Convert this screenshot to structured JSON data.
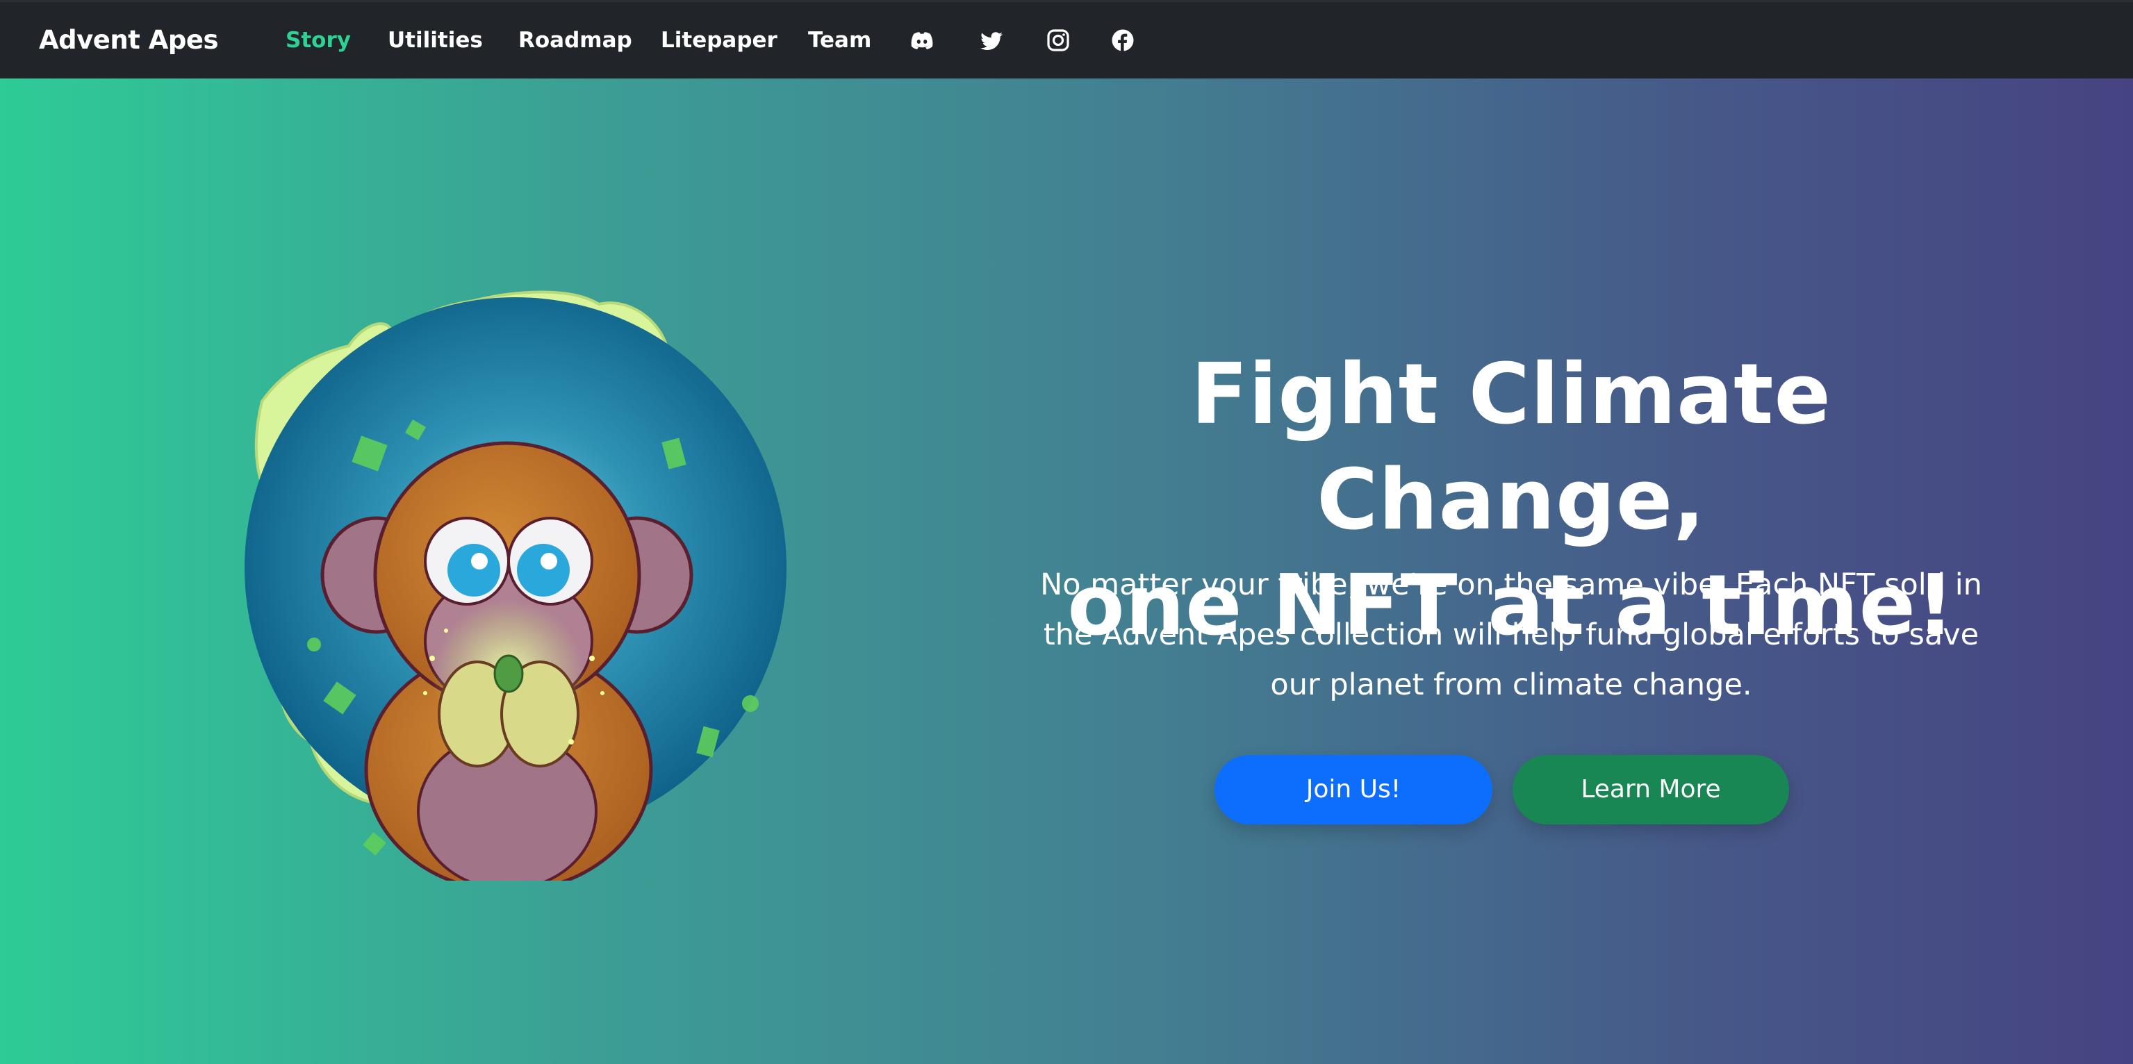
{
  "navbar": {
    "brand": "Advent Apes",
    "links": [
      {
        "label": "Story",
        "active": true
      },
      {
        "label": "Utilities",
        "active": false
      },
      {
        "label": "Roadmap",
        "active": false
      },
      {
        "label": "Litepaper",
        "active": false
      },
      {
        "label": "Team",
        "active": false
      }
    ],
    "social_icons": [
      "discord-icon",
      "twitter-icon",
      "instagram-icon",
      "facebook-icon"
    ],
    "background_color": "#212429",
    "active_color": "#2ed393"
  },
  "hero": {
    "headline_line1": "Fight Climate Change,",
    "headline_line2": "one NFT at a time!",
    "subtitle": "No matter your tribe, we're on the same vibe. Each NFT sold in the Advent Apes collection will help fund global efforts to save our planet from climate change.",
    "primary_button": "Join Us!",
    "secondary_button": "Learn More",
    "gradient_start": "#2ecb96",
    "gradient_end": "#464382",
    "primary_color": "#0d6efd",
    "secondary_color": "#198754",
    "illustration": "ape-holding-glowing-seed"
  }
}
